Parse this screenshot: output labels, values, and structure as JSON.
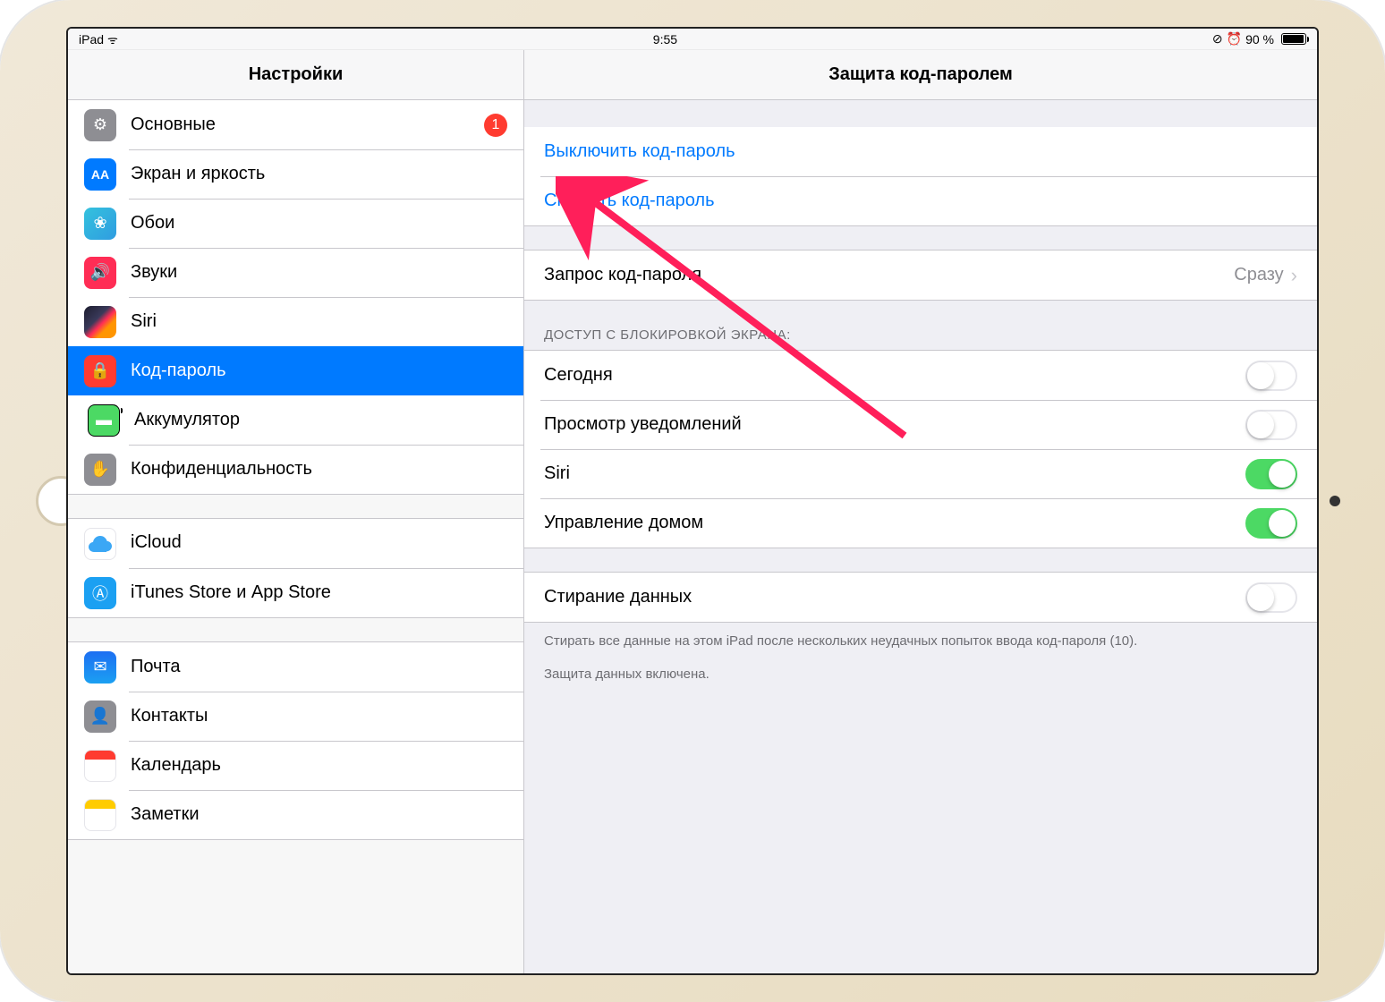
{
  "status": {
    "device": "iPad",
    "time": "9:55",
    "battery_pct": "90 %"
  },
  "header": {
    "left": "Настройки",
    "right": "Защита код-паролем"
  },
  "sidebar": {
    "group1": [
      {
        "label": "Основные",
        "badge": "1"
      },
      {
        "label": "Экран и яркость"
      },
      {
        "label": "Обои"
      },
      {
        "label": "Звуки"
      },
      {
        "label": "Siri"
      },
      {
        "label": "Код-пароль"
      },
      {
        "label": "Аккумулятор"
      },
      {
        "label": "Конфиденциальность"
      }
    ],
    "group2": [
      {
        "label": "iCloud",
        "subtitle": ""
      },
      {
        "label": "iTunes Store и App Store"
      }
    ],
    "group3": [
      {
        "label": "Почта"
      },
      {
        "label": "Контакты"
      },
      {
        "label": "Календарь"
      },
      {
        "label": "Заметки"
      }
    ]
  },
  "content": {
    "turn_off": "Выключить код-пароль",
    "change": "Сменить код-пароль",
    "require": {
      "label": "Запрос код-пароля",
      "value": "Сразу"
    },
    "access_header": "ДОСТУП С БЛОКИРОВКОЙ ЭКРАНА:",
    "access": [
      {
        "label": "Сегодня",
        "on": false
      },
      {
        "label": "Просмотр уведомлений",
        "on": false
      },
      {
        "label": "Siri",
        "on": true
      },
      {
        "label": "Управление домом",
        "on": true
      }
    ],
    "erase": {
      "label": "Стирание данных",
      "on": false
    },
    "erase_footer": "Стирать все данные на этом iPad после нескольких неудачных попыток ввода код-пароля (10).",
    "protection_footer": "Защита данных включена."
  }
}
